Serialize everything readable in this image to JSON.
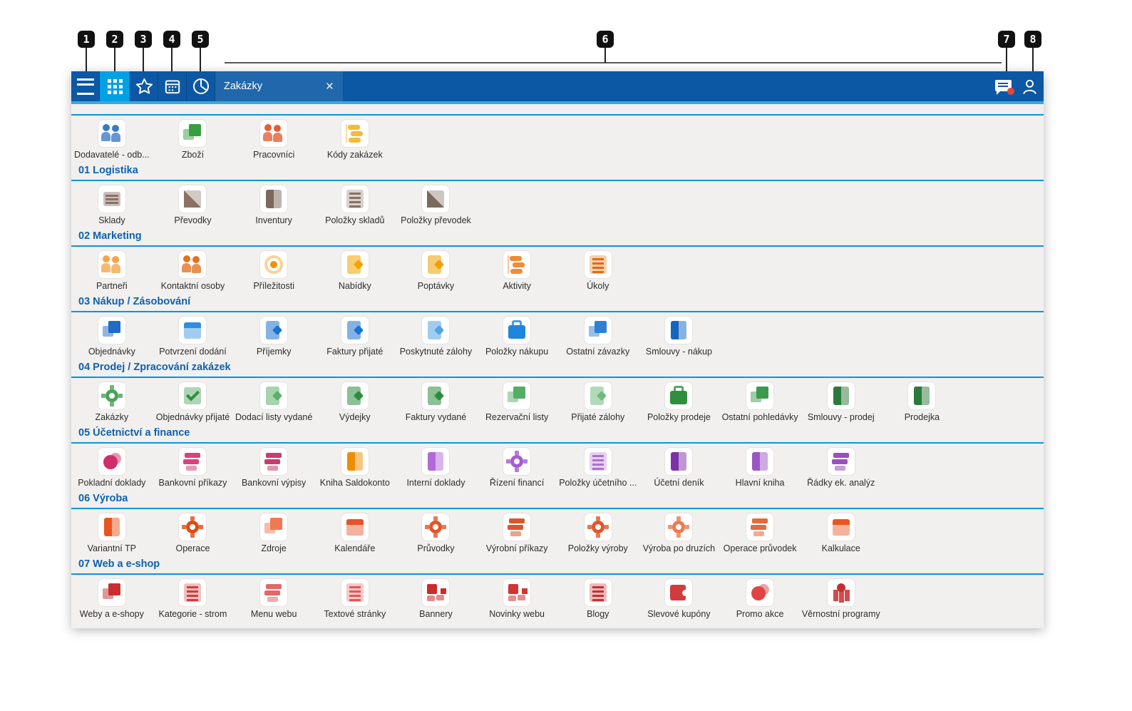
{
  "callouts": {
    "numbers": [
      "1",
      "2",
      "3",
      "4",
      "5",
      "6",
      "7",
      "8"
    ]
  },
  "colors": {
    "titlebar_blue": "#0c58a4",
    "active_button_blue": "#00a1e4",
    "bar_bottom_strip": "#38a8e1",
    "section_line_blue": "#0795dd",
    "section_header_blue": "#0e61ad",
    "content_background": "#f1f0ee",
    "notification_dot_red": "#e8453c"
  },
  "titlebar": {
    "buttons": [
      {
        "icon": "hamburger-menu-icon"
      },
      {
        "icon": "apps-grid-icon",
        "active": true
      },
      {
        "icon": "star-favorites-icon"
      },
      {
        "icon": "calendar-icon"
      },
      {
        "icon": "recent-pie-icon"
      }
    ],
    "tab": {
      "label": "Zakázky",
      "close_icon": "×"
    },
    "right_icons": [
      {
        "icon": "feedback-message-icon"
      },
      {
        "icon": "user-profile-icon"
      }
    ]
  },
  "grid": {
    "top_row_items": [
      {
        "label": "Dodavatelé - odb...",
        "icon": "people-icon",
        "color": "#2a6fc0"
      },
      {
        "label": "Zboží",
        "icon": "boxes-icon",
        "color": "#379f3e"
      },
      {
        "label": "Pracovníci",
        "icon": "people-icon",
        "color": "#e25022"
      },
      {
        "label": "Kódy zakázek",
        "icon": "tags-icon",
        "color": "#f0b428"
      }
    ],
    "sections": [
      {
        "title": "01 Logistika",
        "items": [
          {
            "label": "Sklady",
            "icon": "drawer-icon",
            "color": "#8a7164"
          },
          {
            "label": "Převodky",
            "icon": "split-icon",
            "color": "#8a7164"
          },
          {
            "label": "Inventury",
            "icon": "book-icon",
            "color": "#7c685c"
          },
          {
            "label": "Položky skladů",
            "icon": "list-icon",
            "color": "#8a7164"
          },
          {
            "label": "Položky převodek",
            "icon": "split-icon",
            "color": "#7c685c"
          }
        ]
      },
      {
        "title": "02 Marketing",
        "items": [
          {
            "label": "Partneři",
            "icon": "people-icon",
            "color": "#f59d3a"
          },
          {
            "label": "Kontaktní osoby",
            "icon": "people-icon",
            "color": "#e2660e"
          },
          {
            "label": "Příležitosti",
            "icon": "target-icon",
            "color": "#f39200"
          },
          {
            "label": "Nabídky",
            "icon": "document-icon",
            "color": "#f0a500"
          },
          {
            "label": "Poptávky",
            "icon": "document-icon",
            "color": "#f0a000"
          },
          {
            "label": "Aktivity",
            "icon": "tags-icon",
            "color": "#ef7f23"
          },
          {
            "label": "Úkoly",
            "icon": "list-icon",
            "color": "#e56910"
          }
        ]
      },
      {
        "title": "03 Nákup / Zásobování",
        "items": [
          {
            "label": "Objednávky",
            "icon": "boxes-icon",
            "color": "#1e6bc8"
          },
          {
            "label": "Potvrzení dodání",
            "icon": "calendar-icon",
            "color": "#2e8fe0"
          },
          {
            "label": "Příjemky",
            "icon": "document-icon",
            "color": "#1d72cf"
          },
          {
            "label": "Faktury přijaté",
            "icon": "document-icon",
            "color": "#1d72cf"
          },
          {
            "label": "Poskytnuté zálohy",
            "icon": "document-icon",
            "color": "#54a2e4"
          },
          {
            "label": "Položky nákupu",
            "icon": "briefcase-icon",
            "color": "#1f86dd"
          },
          {
            "label": "Ostatní závazky",
            "icon": "boxes-icon",
            "color": "#2f7fd4"
          },
          {
            "label": "Smlouvy - nákup",
            "icon": "book-icon",
            "color": "#1565c0"
          }
        ]
      },
      {
        "title": "04 Prodej / Zpracování zakázek",
        "items": [
          {
            "label": "Zakázky",
            "icon": "gear-icon",
            "color": "#4ca35a"
          },
          {
            "label": "Objednávky přijaté",
            "icon": "check-icon",
            "color": "#2f8f3f"
          },
          {
            "label": "Dodací listy vydané",
            "icon": "document-icon",
            "color": "#5cb06a"
          },
          {
            "label": "Výdejky",
            "icon": "document-icon",
            "color": "#2e8c3e"
          },
          {
            "label": "Faktury vydané",
            "icon": "document-icon",
            "color": "#2e8c3e"
          },
          {
            "label": "Rezervační listy",
            "icon": "boxes-icon",
            "color": "#55ad63"
          },
          {
            "label": "Přijaté zálohy",
            "icon": "document-icon",
            "color": "#6fbc7e"
          },
          {
            "label": "Položky prodeje",
            "icon": "briefcase-icon",
            "color": "#2f8f3f"
          },
          {
            "label": "Ostatní pohledávky",
            "icon": "boxes-icon",
            "color": "#3c9a4c"
          },
          {
            "label": "Smlouvy - prodej",
            "icon": "book-icon",
            "color": "#2b7a3a"
          },
          {
            "label": "Prodejka",
            "icon": "book-icon",
            "color": "#2b7a3a"
          }
        ]
      },
      {
        "title": "05 Účetnictví a finance",
        "items": [
          {
            "label": "Pokladní doklady",
            "icon": "circles-icon",
            "color": "#cf2f68"
          },
          {
            "label": "Bankovní příkazy",
            "icon": "bars-icon",
            "color": "#d23070"
          },
          {
            "label": "Bankovní výpisy",
            "icon": "bars-icon",
            "color": "#c22a5e"
          },
          {
            "label": "Kniha Saldokonto",
            "icon": "book-icon",
            "color": "#ef8d00"
          },
          {
            "label": "Interní doklady",
            "icon": "book-icon",
            "color": "#b169d6"
          },
          {
            "label": "Řízení financí",
            "icon": "gear-icon",
            "color": "#a75cd0"
          },
          {
            "label": "Položky účetního ...",
            "icon": "list-icon",
            "color": "#ad6fd2"
          },
          {
            "label": "Účetní deník",
            "icon": "book-icon",
            "color": "#7f30a8"
          },
          {
            "label": "Hlavní kniha",
            "icon": "book-icon",
            "color": "#9c55c4"
          },
          {
            "label": "Řádky ek. analýz",
            "icon": "bars-icon",
            "color": "#8e3fb4"
          }
        ]
      },
      {
        "title": "06 Výroba",
        "items": [
          {
            "label": "Variantní TP",
            "icon": "book-icon",
            "color": "#e8561f"
          },
          {
            "label": "Operace",
            "icon": "gear-icon",
            "color": "#e04c12"
          },
          {
            "label": "Zdroje",
            "icon": "boxes-icon",
            "color": "#ef7a52"
          },
          {
            "label": "Kalendáře",
            "icon": "calendar-icon",
            "color": "#e5542a"
          },
          {
            "label": "Průvodky",
            "icon": "gear-icon",
            "color": "#e5542a"
          },
          {
            "label": "Výrobní příkazy",
            "icon": "bars-icon",
            "color": "#d84315"
          },
          {
            "label": "Položky výroby",
            "icon": "gear-icon",
            "color": "#e5542a"
          },
          {
            "label": "Výroba po druzích",
            "icon": "gear-icon",
            "color": "#ef7a52"
          },
          {
            "label": "Operace průvodek",
            "icon": "bars-icon",
            "color": "#e05a28"
          },
          {
            "label": "Kalkulace",
            "icon": "calendar-icon",
            "color": "#e8561f"
          }
        ]
      },
      {
        "title": "07 Web a e-shop",
        "items": [
          {
            "label": "Weby a e-shopy",
            "icon": "boxes-icon",
            "color": "#c62f2f"
          },
          {
            "label": "Kategorie - strom",
            "icon": "list-icon",
            "color": "#d23b3b"
          },
          {
            "label": "Menu webu",
            "icon": "bars-icon",
            "color": "#e25757"
          },
          {
            "label": "Textové stránky",
            "icon": "list-icon",
            "color": "#e25757"
          },
          {
            "label": "Bannery",
            "icon": "grid-icon",
            "color": "#cc2b2b"
          },
          {
            "label": "Novinky webu",
            "icon": "grid-icon",
            "color": "#d33333"
          },
          {
            "label": "Blogy",
            "icon": "list-icon",
            "color": "#c62f2f"
          },
          {
            "label": "Slevové kupóny",
            "icon": "ticket-icon",
            "color": "#d23b3b"
          },
          {
            "label": "Promo akce",
            "icon": "circles-icon",
            "color": "#e04444"
          },
          {
            "label": "Věrnostní programy",
            "icon": "shop-icon",
            "color": "#c62f2f"
          }
        ]
      }
    ]
  }
}
